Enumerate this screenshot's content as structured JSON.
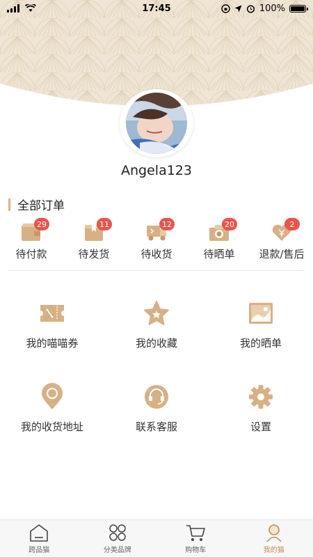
{
  "status_bar": {
    "time": "17:45",
    "battery_text": "100%",
    "battery_level": 1.0
  },
  "profile": {
    "username": "Angela123"
  },
  "orders": {
    "title": "全部订单",
    "items": [
      {
        "label": "待付款",
        "badge": "29",
        "icon": "wallet-icon"
      },
      {
        "label": "待发货",
        "badge": "11",
        "icon": "package-icon"
      },
      {
        "label": "待收货",
        "badge": "12",
        "icon": "delivery-truck-icon"
      },
      {
        "label": "待晒单",
        "badge": "20",
        "icon": "camera-icon"
      },
      {
        "label": "退款/售后",
        "badge": "2",
        "icon": "refund-heart-icon"
      }
    ]
  },
  "services": [
    {
      "label": "我的喵喵券",
      "icon": "coupon-icon"
    },
    {
      "label": "我的收藏",
      "icon": "star-icon"
    },
    {
      "label": "我的晒单",
      "icon": "photo-icon"
    },
    {
      "label": "我的收货地址",
      "icon": "location-pin-icon"
    },
    {
      "label": "联系客服",
      "icon": "headset-icon"
    },
    {
      "label": "设置",
      "icon": "gear-icon"
    }
  ],
  "tabs": [
    {
      "label": "跨品猫",
      "icon": "home-icon"
    },
    {
      "label": "分类品牌",
      "icon": "categories-icon"
    },
    {
      "label": "购物车",
      "icon": "cart-icon"
    },
    {
      "label": "我的猫",
      "icon": "profile-icon"
    }
  ],
  "active_tab": "我的猫",
  "colors": {
    "accent": "#d7b58a",
    "icon_gold": "#d4aa7b",
    "badge_red": "#e8554d",
    "header_bg": "#efe4d2",
    "active_tab": "#c08c55"
  }
}
